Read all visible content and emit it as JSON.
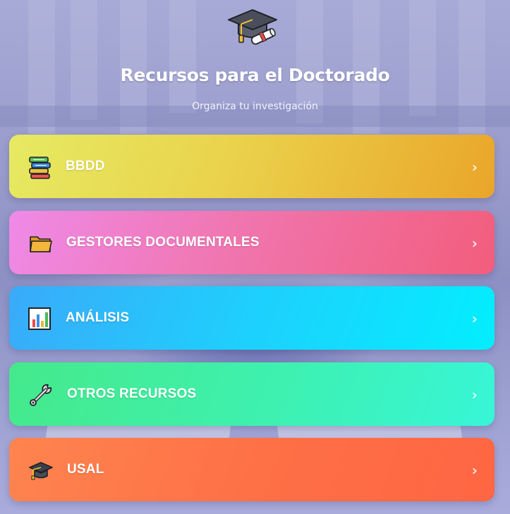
{
  "header": {
    "icon": "graduation-cap-diploma-icon",
    "title": "Recursos para el Doctorado",
    "subtitle": "Organiza tu investigación"
  },
  "cards": [
    {
      "label": "BBDD",
      "icon": "books-icon",
      "chevron": "›",
      "color_start": "#e6ea62",
      "color_end": "#eaa52a"
    },
    {
      "label": "GESTORES DOCUMENTALES",
      "icon": "folder-icon",
      "chevron": "›",
      "color_start": "#ef8ae8",
      "color_end": "#f25d7c"
    },
    {
      "label": "ANÁLISIS",
      "icon": "bar-chart-icon",
      "chevron": "›",
      "color_start": "#3aaaf9",
      "color_end": "#02eefe"
    },
    {
      "label": "OTROS RECURSOS",
      "icon": "wrench-icon",
      "chevron": "›",
      "color_start": "#45e98a",
      "color_end": "#37f6d8"
    },
    {
      "label": "USAL",
      "icon": "graduation-cap-icon",
      "chevron": "›",
      "color_start": "#fe844f",
      "color_end": "#ff6643"
    }
  ]
}
